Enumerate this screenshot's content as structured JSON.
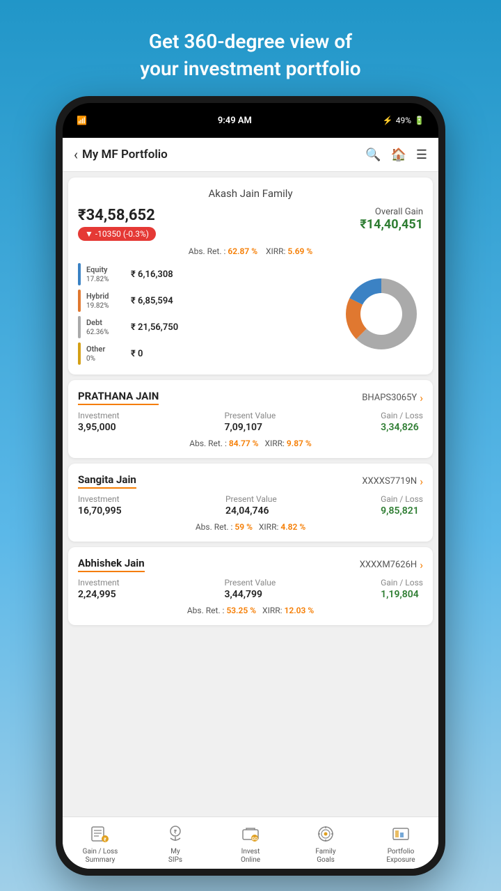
{
  "header": {
    "tagline_line1": "Get 360-degree view of",
    "tagline_line2": "your investment portfolio"
  },
  "status_bar": {
    "time": "9:49 AM",
    "battery": "49%"
  },
  "app_header": {
    "title": "My MF Portfolio",
    "back_label": "‹"
  },
  "portfolio": {
    "family_name": "Akash Jain Family",
    "total_value": "₹34,58,652",
    "change": "▼ -10350 (-0.3%)",
    "overall_gain_label": "Overall Gain",
    "overall_gain_value": "₹14,40,451",
    "abs_ret_label": "Abs. Ret. :",
    "abs_ret_value": "62.87 %",
    "xirr_label": "XIRR:",
    "xirr_value": "5.69 %",
    "categories": [
      {
        "name": "Equity",
        "pct": "17.82%",
        "value": "₹ 6,16,308",
        "color": "#3b82c4"
      },
      {
        "name": "Hybrid",
        "pct": "19.82%",
        "value": "₹ 6,85,594",
        "color": "#e07830"
      },
      {
        "name": "Debt",
        "pct": "62.36%",
        "value": "₹ 21,56,750",
        "color": "#aaaaaa"
      },
      {
        "name": "Other",
        "pct": "0%",
        "value": "₹ 0",
        "color": "#d4a017"
      }
    ],
    "chart": {
      "segments": [
        {
          "label": "Equity",
          "pct": 17.82,
          "color": "#3b82c4"
        },
        {
          "label": "Hybrid",
          "pct": 19.82,
          "color": "#e07830"
        },
        {
          "label": "Debt",
          "pct": 62.36,
          "color": "#aaaaaa"
        }
      ]
    }
  },
  "members": [
    {
      "name": "PRATHANA JAIN",
      "id": "BHAPS3065Y",
      "investment": "3,95,000",
      "present_value": "7,09,107",
      "gain_loss": "3,34,826",
      "abs_ret": "84.77 %",
      "xirr": "9.87 %"
    },
    {
      "name": "Sangita Jain",
      "id": "XXXXS7719N",
      "investment": "16,70,995",
      "present_value": "24,04,746",
      "gain_loss": "9,85,821",
      "abs_ret": "59 %",
      "xirr": "4.82 %"
    },
    {
      "name": "Abhishek Jain",
      "id": "XXXXM7626H",
      "investment": "2,24,995",
      "present_value": "3,44,799",
      "gain_loss": "1,19,804",
      "abs_ret": "53.25 %",
      "xirr": "12.03 %"
    }
  ],
  "bottom_nav": [
    {
      "id": "gain-loss",
      "label": "Gain / Loss\nSummary",
      "icon": "gain-loss-icon"
    },
    {
      "id": "my-sips",
      "label": "My\nSIPs",
      "icon": "sip-icon"
    },
    {
      "id": "invest-online",
      "label": "Invest\nOnline",
      "icon": "invest-icon"
    },
    {
      "id": "family-goals",
      "label": "Family\nGoals",
      "icon": "goals-icon"
    },
    {
      "id": "portfolio-exposure",
      "label": "Portfolio\nExposure",
      "icon": "exposure-icon"
    }
  ]
}
